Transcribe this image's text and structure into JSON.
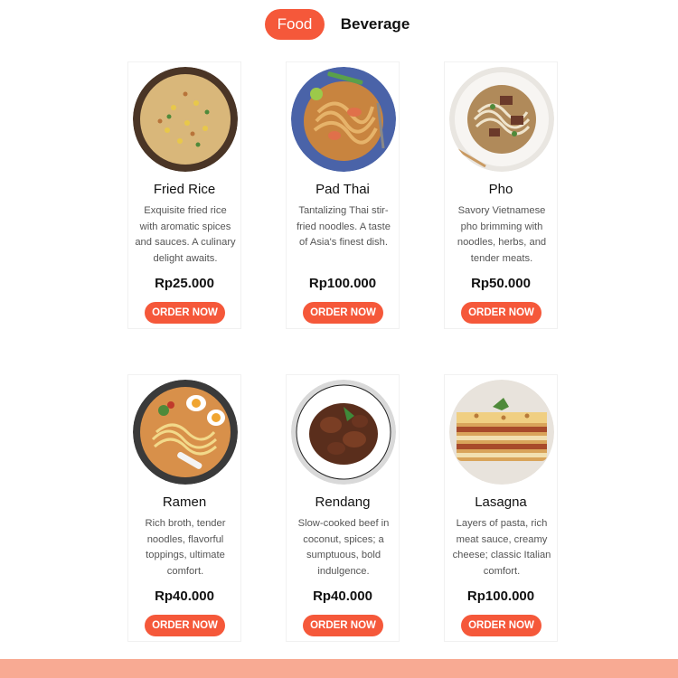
{
  "tabs": {
    "food": "Food",
    "beverage": "Beverage"
  },
  "menu": {
    "items": [
      {
        "name": "Fried Rice",
        "description": "Exquisite fried rice with aromatic spices and sauces. A culinary delight awaits.",
        "price": "Rp25.000",
        "order_label": "ORDER NOW",
        "image_icon": "fried-rice-image"
      },
      {
        "name": "Pad Thai",
        "description": "Tantalizing Thai stir-fried noodles. A taste of Asia's finest dish.",
        "price": "Rp100.000",
        "order_label": "ORDER NOW",
        "image_icon": "pad-thai-image"
      },
      {
        "name": "Pho",
        "description": "Savory Vietnamese pho brimming with noodles, herbs, and tender meats.",
        "price": "Rp50.000",
        "order_label": "ORDER NOW",
        "image_icon": "pho-image"
      },
      {
        "name": "Ramen",
        "description": "Rich broth, tender noodles, flavorful toppings, ultimate comfort.",
        "price": "Rp40.000",
        "order_label": "ORDER NOW",
        "image_icon": "ramen-image"
      },
      {
        "name": "Rendang",
        "description": "Slow-cooked beef in coconut, spices; a sumptuous, bold indulgence.",
        "price": "Rp40.000",
        "order_label": "ORDER NOW",
        "image_icon": "rendang-image"
      },
      {
        "name": "Lasagna",
        "description": "Layers of pasta, rich meat sauce, creamy cheese; classic Italian comfort.",
        "price": "Rp100.000",
        "order_label": "ORDER NOW",
        "image_icon": "lasagna-image"
      }
    ]
  },
  "colors": {
    "accent": "#f5583a",
    "footer": "#f8aa93"
  }
}
